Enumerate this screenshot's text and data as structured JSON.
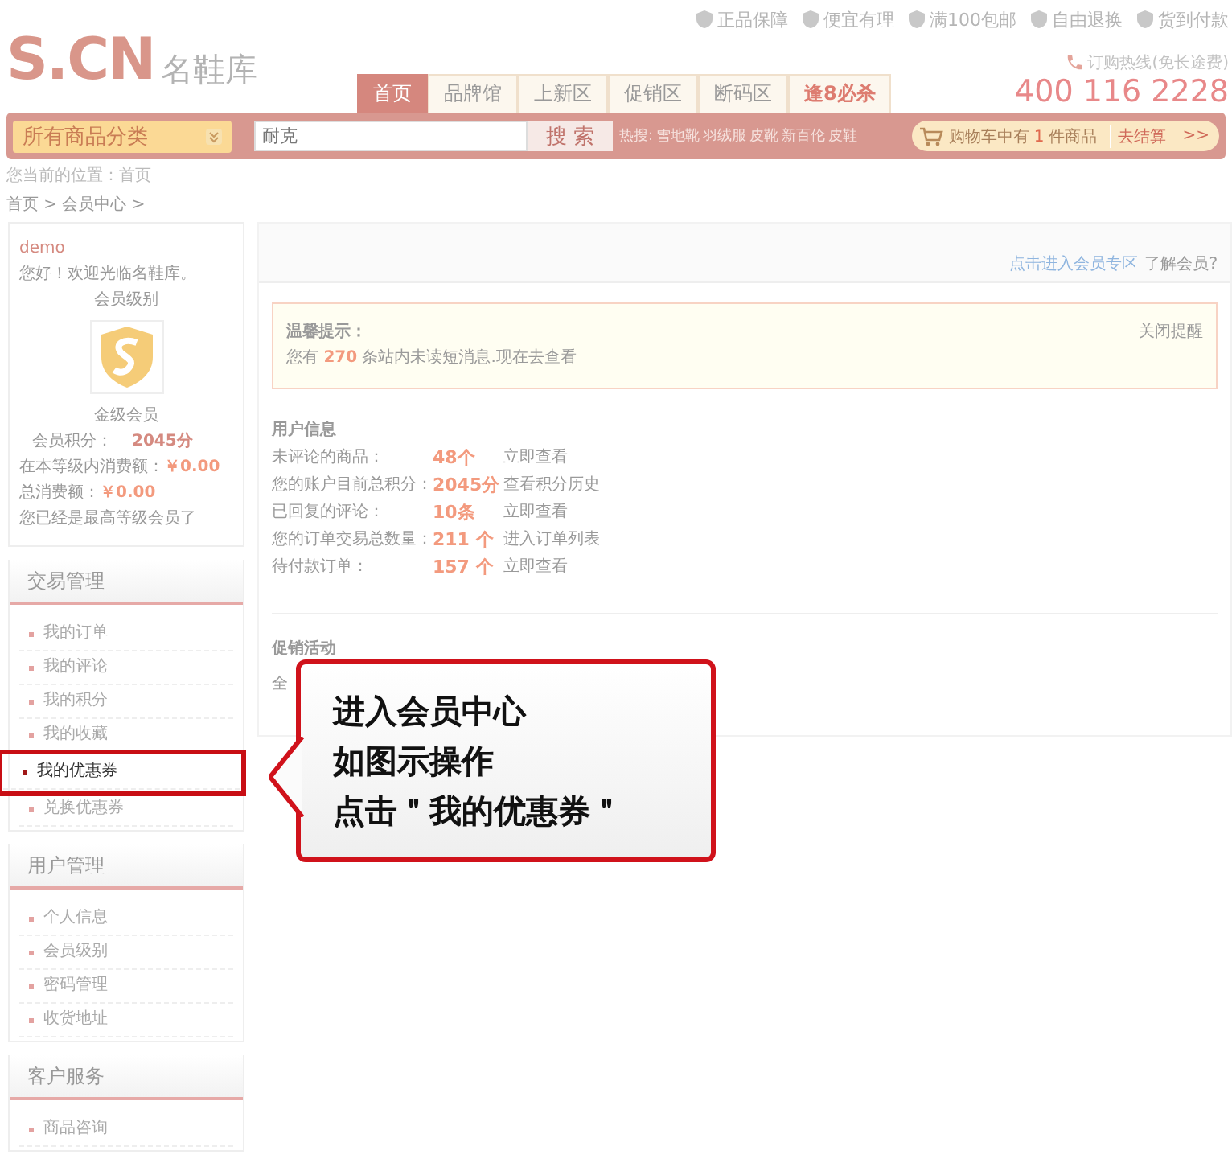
{
  "top_links": [
    {
      "label": "正品保障"
    },
    {
      "label": "便宜有理"
    },
    {
      "label": "满100包邮"
    },
    {
      "label": "自由退换"
    },
    {
      "label": "货到付款"
    }
  ],
  "logo": {
    "mark": "S.CN",
    "name": "名鞋库"
  },
  "nav_tabs": [
    {
      "label": "首页",
      "selected": true,
      "kind": "normal"
    },
    {
      "label": "品牌馆",
      "selected": false,
      "kind": "normal"
    },
    {
      "label": "上新区",
      "selected": false,
      "kind": "normal"
    },
    {
      "label": "促销区",
      "selected": false,
      "kind": "normal"
    },
    {
      "label": "断码区",
      "selected": false,
      "kind": "normal"
    },
    {
      "label": "逢8必杀",
      "selected": false,
      "kind": "special"
    }
  ],
  "hotline": {
    "label": "订购热线(免长途费)",
    "phone": "400 116 2228"
  },
  "search_bar": {
    "category": "所有商品分类",
    "value": "耐克",
    "button": "搜 索",
    "hot_label": "热搜:",
    "hot_terms": [
      "雪地靴",
      "羽绒服",
      "皮靴",
      "新百伦",
      "皮鞋"
    ],
    "cart_before": "购物车中有",
    "cart_count": "1",
    "cart_after": "件商品",
    "checkout": "去结算",
    "checkout_arrow": ">>"
  },
  "location": {
    "label": "您当前的位置：",
    "value": "首页"
  },
  "breadcrumb": "首页 > 会员中心 >",
  "profile": {
    "username": "demo",
    "greeting": "您好！欢迎光临名鞋库。",
    "level_label": "会员级别",
    "level_name": "金级会员",
    "points_label": "会员积分：",
    "points": "2045分",
    "spend_rows": [
      {
        "label": "在本等级内消费额：",
        "value": "￥0.00"
      },
      {
        "label": "总消费额：",
        "value": "￥0.00"
      }
    ],
    "note": "您已经是最高等级会员了"
  },
  "menu_sections": [
    {
      "title": "交易管理",
      "items": [
        {
          "label": "我的订单",
          "selected": false
        },
        {
          "label": "我的评论",
          "selected": false
        },
        {
          "label": "我的积分",
          "selected": false
        },
        {
          "label": "我的收藏",
          "selected": false
        },
        {
          "label": "我的优惠券",
          "selected": true
        },
        {
          "label": "兑换优惠券",
          "selected": false
        }
      ]
    },
    {
      "title": "用户管理",
      "items": [
        {
          "label": "个人信息",
          "selected": false
        },
        {
          "label": "会员级别",
          "selected": false
        },
        {
          "label": "密码管理",
          "selected": false
        },
        {
          "label": "收货地址",
          "selected": false
        }
      ]
    },
    {
      "title": "客户服务",
      "items": [
        {
          "label": "商品咨询",
          "selected": false
        }
      ]
    }
  ],
  "member_links": {
    "link": "点击进入会员专区",
    "text": "了解会员?"
  },
  "notice": {
    "title": "温馨提示：",
    "close": "关闭提醒",
    "before": "您有",
    "count": "270",
    "after": "条站内未读短消息.现在去查看"
  },
  "user_info": {
    "title": "用户信息",
    "rows": [
      {
        "label": "未评论的商品：",
        "value": "48个",
        "action": "立即查看"
      },
      {
        "label": "您的账户目前总积分：",
        "value": "2045分",
        "action": "查看积分历史"
      },
      {
        "label": "已回复的评论：",
        "value": "10条",
        "action": "立即查看"
      },
      {
        "label": "您的订单交易总数量：",
        "value": "211 个",
        "action": "进入订单列表"
      },
      {
        "label": "待付款订单：",
        "value": "157 个",
        "action": "立即查看"
      }
    ]
  },
  "promotions": {
    "title": "促销活动",
    "text": "全"
  },
  "callout": {
    "lines": [
      "进入会员中心",
      "如图示操作",
      "点击＂我的优惠券＂"
    ]
  }
}
